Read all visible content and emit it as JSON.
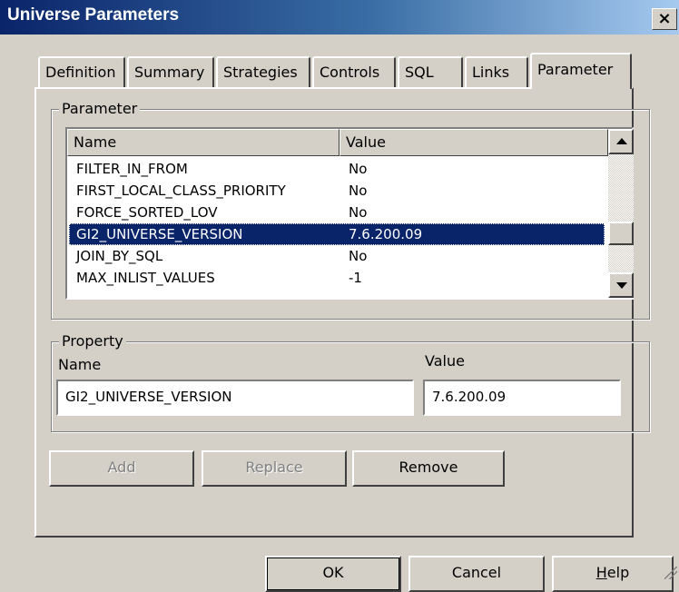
{
  "window": {
    "title": "Universe Parameters",
    "close_label": "×"
  },
  "tabs": [
    "Definition",
    "Summary",
    "Strategies",
    "Controls",
    "SQL",
    "Links",
    "Parameter"
  ],
  "parameter_group": {
    "legend": "Parameter",
    "columns": {
      "name": "Name",
      "value": "Value"
    },
    "rows": [
      {
        "name": "FILTER_IN_FROM",
        "value": "No"
      },
      {
        "name": "FIRST_LOCAL_CLASS_PRIORITY",
        "value": "No"
      },
      {
        "name": "FORCE_SORTED_LOV",
        "value": "No"
      },
      {
        "name": "GI2_UNIVERSE_VERSION",
        "value": "7.6.200.09"
      },
      {
        "name": "JOIN_BY_SQL",
        "value": "No"
      },
      {
        "name": "MAX_INLIST_VALUES",
        "value": "-1"
      }
    ],
    "selected_row": 3
  },
  "property_group": {
    "legend": "Property",
    "name_label": "Name",
    "value_label": "Value",
    "name_value": "GI2_UNIVERSE_VERSION",
    "value_value": "7.6.200.09"
  },
  "buttons": {
    "add": "Add",
    "replace": "Replace",
    "remove": "Remove",
    "ok": "OK",
    "cancel": "Cancel",
    "help": "Help"
  },
  "colors": {
    "selection": "#0a246a",
    "face": "#d4d0c8",
    "title_start": "#0a246a"
  }
}
